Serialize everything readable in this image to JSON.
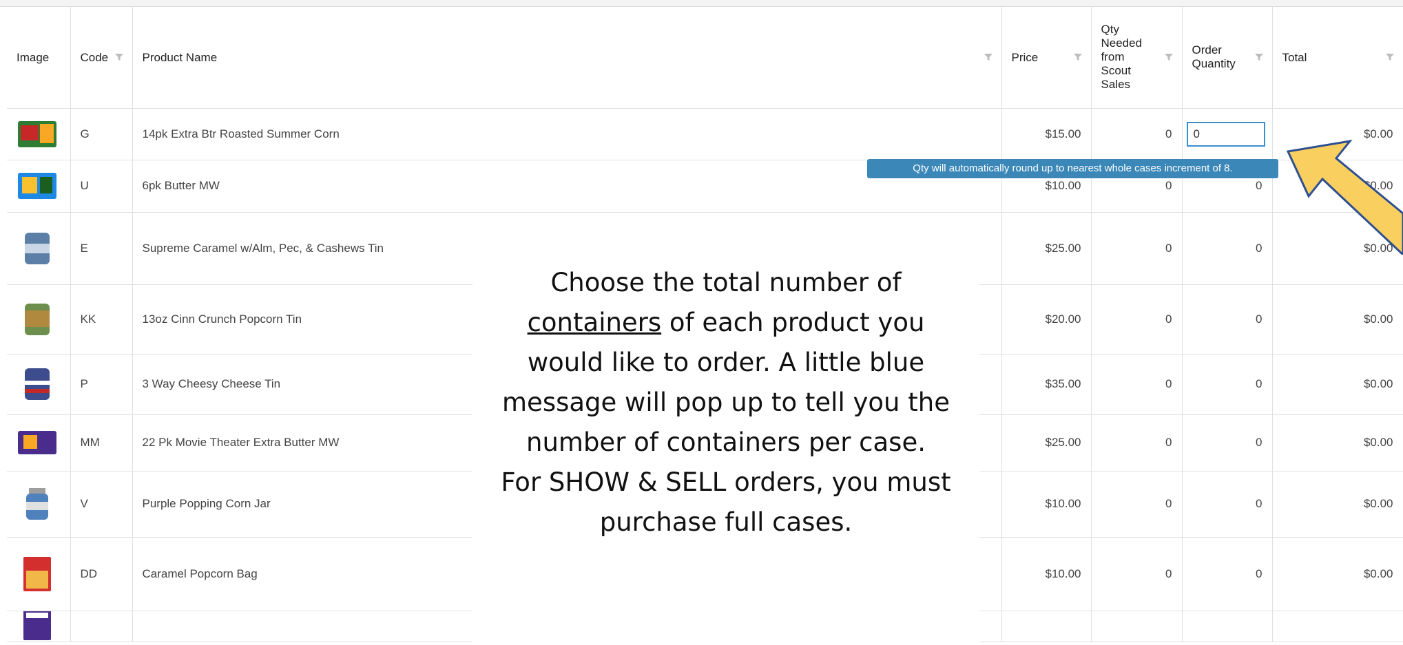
{
  "table": {
    "columns": [
      {
        "key": "image",
        "label": "Image",
        "filter": false
      },
      {
        "key": "code",
        "label": "Code",
        "filter": true
      },
      {
        "key": "product",
        "label": "Product Name",
        "filter": true
      },
      {
        "key": "price",
        "label": "Price",
        "filter": true
      },
      {
        "key": "qty_needed",
        "label": "Qty Needed from Scout Sales",
        "filter": true
      },
      {
        "key": "order_qty",
        "label": "Order Quantity",
        "filter": true
      },
      {
        "key": "total",
        "label": "Total",
        "filter": true
      }
    ],
    "rows": [
      {
        "code": "G",
        "name": "14pk Extra Btr Roasted Summer Corn",
        "price": "$15.00",
        "qty_needed": "0",
        "order_qty": "0",
        "total": "$0.00",
        "thumb": "green-box"
      },
      {
        "code": "U",
        "name": "6pk Butter MW",
        "price": "$10.00",
        "qty_needed": "0",
        "order_qty": "0",
        "total": "$0.00",
        "thumb": "blue-box"
      },
      {
        "code": "E",
        "name": "Supreme Caramel w/Alm, Pec, & Cashews Tin",
        "price": "$25.00",
        "qty_needed": "0",
        "order_qty": "0",
        "total": "$0.00",
        "thumb": "tin-blue"
      },
      {
        "code": "KK",
        "name": "13oz Cinn Crunch Popcorn Tin",
        "price": "$20.00",
        "qty_needed": "0",
        "order_qty": "0",
        "total": "$0.00",
        "thumb": "tin-green"
      },
      {
        "code": "P",
        "name": "3 Way Cheesy Cheese Tin",
        "price": "$35.00",
        "qty_needed": "0",
        "order_qty": "0",
        "total": "$0.00",
        "thumb": "tin-flag"
      },
      {
        "code": "MM",
        "name": "22 Pk Movie Theater Extra Butter MW",
        "price": "$25.00",
        "qty_needed": "0",
        "order_qty": "0",
        "total": "$0.00",
        "thumb": "purple-box"
      },
      {
        "code": "V",
        "name": "Purple Popping Corn Jar",
        "price": "$10.00",
        "qty_needed": "0",
        "order_qty": "0",
        "total": "$0.00",
        "thumb": "jar"
      },
      {
        "code": "DD",
        "name": "Caramel Popcorn Bag",
        "price": "$10.00",
        "qty_needed": "0",
        "order_qty": "0",
        "total": "$0.00",
        "thumb": "red-bag"
      },
      {
        "code": "",
        "name": "",
        "price": "",
        "qty_needed": "",
        "order_qty": "",
        "total": "",
        "thumb": "purple-bag"
      }
    ]
  },
  "tooltip": {
    "text": "Qty will automatically round up to nearest whole cases increment of 8."
  },
  "instructions": {
    "line1": "Choose the total number of",
    "line2_underlined": "containers",
    "line2_rest": " of each product you",
    "line3": "would like to order.  A little blue",
    "line4": "message will pop up to tell you the",
    "line5": "number of containers per case.",
    "line6": "For SHOW & SELL orders, you must",
    "line7": "purchase full cases."
  },
  "colors": {
    "tooltip_bg": "#3a87b8",
    "arrow_fill": "#f9cf5f",
    "arrow_stroke": "#2f4f8f",
    "focus_border": "#3b8ed0"
  }
}
